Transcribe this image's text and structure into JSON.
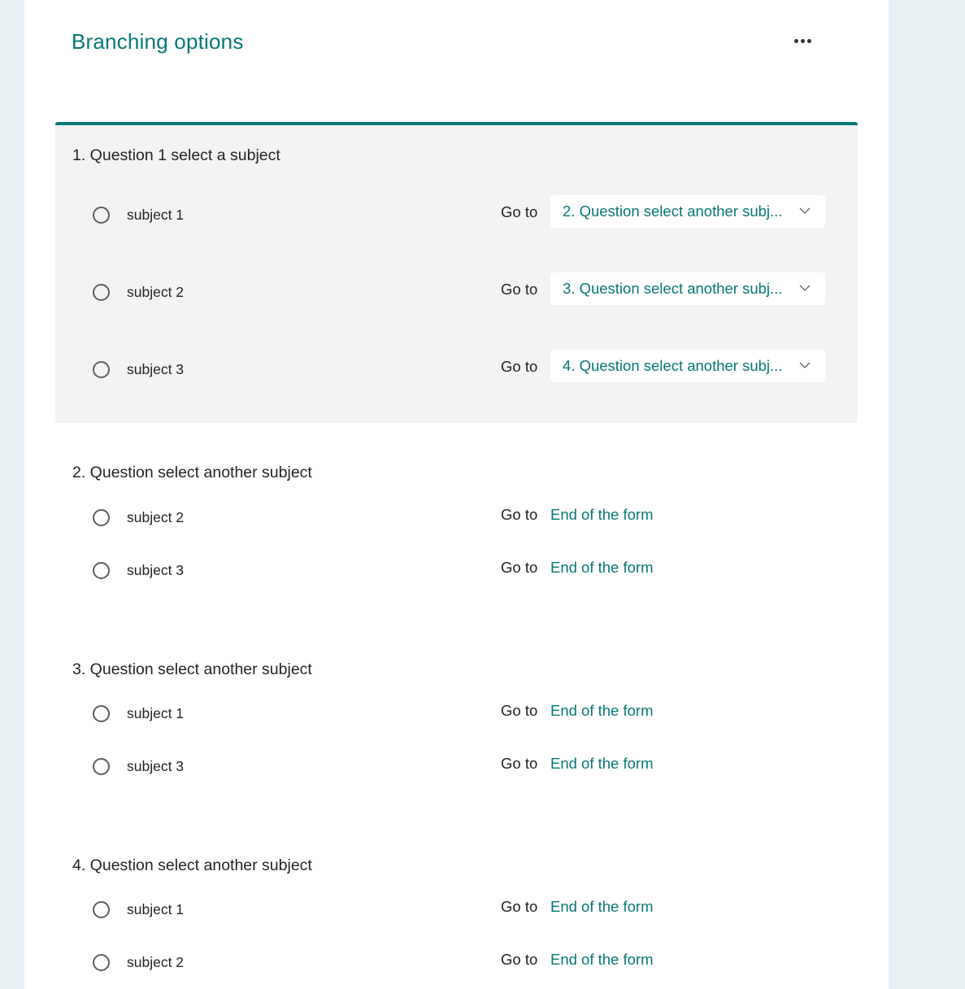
{
  "header": {
    "title": "Branching options",
    "more_icon": "more-horizontal-icon"
  },
  "colors": {
    "accent": "#077775",
    "page_bg": "#e8f0f3",
    "panel_bg": "#ffffff",
    "active_card_bg": "#f3f3f3",
    "text": "#252423"
  },
  "goto_label": "Go to",
  "questions": [
    {
      "title": "1. Question 1 select a subject",
      "options": [
        {
          "label": "subject 1",
          "goto": "2. Question select another subj...",
          "is_dropdown": true
        },
        {
          "label": "subject 2",
          "goto": "3. Question select another subj...",
          "is_dropdown": true
        },
        {
          "label": "subject 3",
          "goto": "4. Question select another subj...",
          "is_dropdown": true
        }
      ]
    },
    {
      "title": "2. Question select another subject",
      "options": [
        {
          "label": "subject 2",
          "goto": "End of the form"
        },
        {
          "label": "subject 3",
          "goto": "End of the form"
        }
      ]
    },
    {
      "title": "3. Question select another subject",
      "options": [
        {
          "label": "subject 1",
          "goto": "End of the form"
        },
        {
          "label": "subject 3",
          "goto": "End of the form"
        }
      ]
    },
    {
      "title": "4. Question select another subject",
      "options": [
        {
          "label": "subject 1",
          "goto": "End of the form"
        },
        {
          "label": "subject 2",
          "goto": "End of the form"
        }
      ]
    }
  ]
}
